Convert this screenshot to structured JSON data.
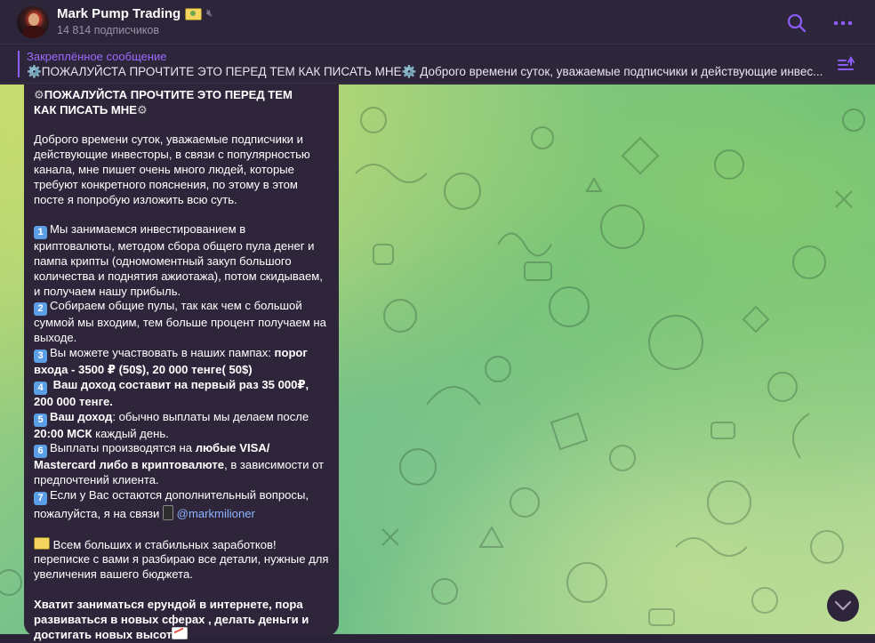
{
  "header": {
    "channel_title": "Mark Pump Trading",
    "subscribers": "14 814 подписчиков"
  },
  "pinned": {
    "label": "Закреплённое сообщение",
    "text": "⚙️ПОЖАЛУЙСТА ПРОЧТИТЕ ЭТО ПЕРЕД ТЕМ КАК ПИСАТЬ МНЕ⚙️  Доброго времени суток, уважаемые подписчики и действующие инвес..."
  },
  "message": {
    "heading_line1": "ПОЖАЛУЙСТА ПРОЧТИТЕ ЭТО ПЕРЕД ТЕМ",
    "heading_line2": "КАК ПИСАТЬ МНЕ",
    "intro": "Доброго времени суток, уважаемые подписчики и действующие инвесторы, в связи с популярностью канала, мне пишет очень много людей, которые требуют конкретного пояснения, по этому в этом посте я попробую изложить всю суть.",
    "p1": "Мы занимаемся инвестированием в криптовалюты, методом сбора общего пула денег и пампа крипты (одномоментный закуп большого количества и поднятия ажиотажа), потом скидываем, и получаем нашу прибыль.",
    "p2": "Собираем общие пулы, так как чем с большой суммой мы входим, тем больше процент получаем на выходе.",
    "p3_plain": "Вы можете участвовать в наших пампах: ",
    "p3_bold": "порог входа - 3500 ₽ (50$), 20 000 тенге( 50$)",
    "p4_bold": " Ваш доход составит на первый раз 35 000₽, 200 000 тенге.",
    "p5_bold": "Ваш доход",
    "p5_plain1": ": обычно выплаты мы делаем после ",
    "p5_bold2": "20:00 МСК",
    "p5_plain2": " каждый день.",
    "p6_plain1": "Выплаты производятся на ",
    "p6_bold": "любые VISA/ Mastercard либо в криптовалюте",
    "p6_plain2": ", в зависимости от предпочтений клиента.",
    "p7": "Если у Вас остаются дополнительный вопросы, пожалуйста, я на связи",
    "contact_link": "@markmilioner",
    "wish": "Всем больших и стабильных заработков! переписке с вами я разбираю все детали, нужные для увеличения вашего бюджета.",
    "closing": "Хватит заниматься ерундой в интернете, пора развиваться в новых сферах , делать деньги и достигать новых высот",
    "numbers": [
      "1",
      "2",
      "3",
      "4",
      "5",
      "6",
      "7"
    ]
  },
  "colors": {
    "accent": "#8a5cf5",
    "link": "#8cb4ff",
    "bubble": "#2e253a"
  },
  "icons": [
    "search-icon",
    "more-icon",
    "pinned-list-icon",
    "chevron-down-icon",
    "gear-icon",
    "money-icon",
    "mute-icon"
  ]
}
